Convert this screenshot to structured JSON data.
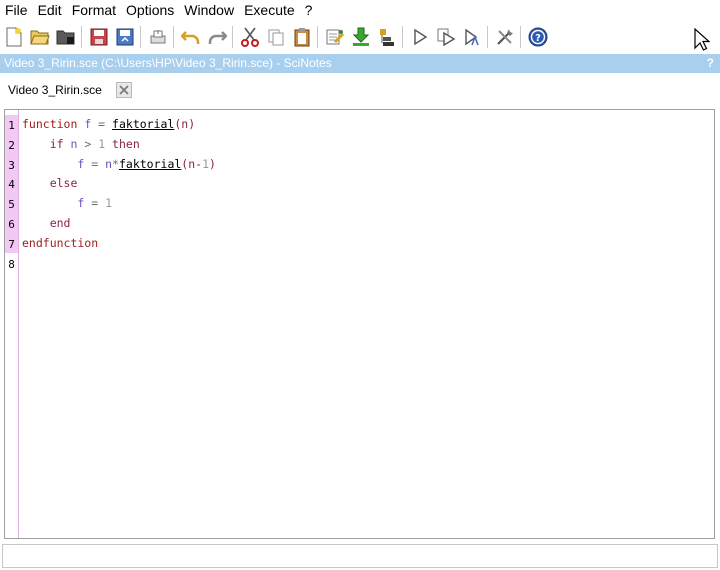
{
  "menu": [
    "File",
    "Edit",
    "Format",
    "Options",
    "Window",
    "Execute",
    "?"
  ],
  "toolbar": {
    "icons": [
      "new-file-icon",
      "open-file-icon",
      "open-folder-icon",
      "save-icon",
      "save-as-icon",
      "print-icon",
      "undo-icon",
      "redo-icon",
      "cut-icon",
      "copy-icon",
      "paste-icon",
      "find-replace-icon",
      "load-into-console-icon",
      "execute-file-icon",
      "run-icon",
      "run-step-icon",
      "run-debug-icon",
      "settings-icon",
      "help-icon"
    ]
  },
  "window": {
    "title": "Video 3_Ririn.sce (C:\\Users\\HP\\Video 3_Ririn.sce) - SciNotes",
    "help_mark": "?"
  },
  "tab": {
    "label": "Video 3_Ririn.sce"
  },
  "editor": {
    "line_numbers": [
      "1",
      "2",
      "3",
      "4",
      "5",
      "6",
      "7",
      "8"
    ],
    "lines": [
      [
        {
          "t": "function",
          "c": "kw"
        },
        {
          "t": " f ",
          "c": "id"
        },
        {
          "t": "=",
          "c": "op"
        },
        {
          "t": " ",
          "c": "op"
        },
        {
          "t": "faktorial",
          "c": "fn"
        },
        {
          "t": "(n)",
          "c": "kw2"
        }
      ],
      [
        {
          "t": "    if",
          "c": "kw2"
        },
        {
          "t": " n ",
          "c": "id"
        },
        {
          "t": ">",
          "c": "op"
        },
        {
          "t": " 1 ",
          "c": "num"
        },
        {
          "t": "then",
          "c": "kw2"
        }
      ],
      [
        {
          "t": "        f ",
          "c": "id"
        },
        {
          "t": "=",
          "c": "op"
        },
        {
          "t": " n",
          "c": "id"
        },
        {
          "t": "*",
          "c": "op"
        },
        {
          "t": "faktorial",
          "c": "fn"
        },
        {
          "t": "(n-",
          "c": "kw2"
        },
        {
          "t": "1",
          "c": "num"
        },
        {
          "t": ")",
          "c": "kw2"
        }
      ],
      [
        {
          "t": "    else",
          "c": "kw2"
        }
      ],
      [
        {
          "t": "        f ",
          "c": "id"
        },
        {
          "t": "=",
          "c": "op"
        },
        {
          "t": " 1",
          "c": "num"
        }
      ],
      [
        {
          "t": "    end",
          "c": "kw2"
        }
      ],
      [
        {
          "t": "endfunction",
          "c": "kw"
        }
      ],
      []
    ]
  }
}
